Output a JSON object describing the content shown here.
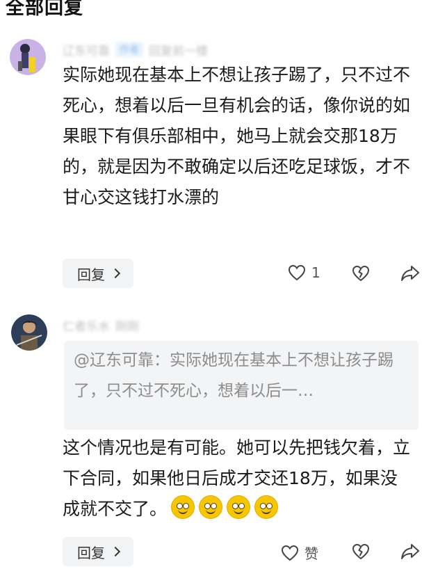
{
  "section_title": "全部回复",
  "comments": [
    {
      "username": "辽东可靠",
      "author_tag": "作者",
      "meta": "回复前一楼",
      "text": "实际她现在基本上不想让孩子踢了，只不过不死心，想着以后一旦有机会的话，像你说的如果眼下有俱乐部相中，她马上就会交那18万的，就是因为不敢确定以后还吃足球饭，才不甘心交这钱打水漂的",
      "reply_label": "回复",
      "like_count": "1"
    },
    {
      "username": "仁者乐水",
      "meta": "刚刚",
      "quote": "@辽东可靠：实际她现在基本上不想让孩子踢了，只不过不死心，想着以后一…",
      "text": "这个情况也是有可能。她可以先把钱欠着，立下合同，如果他日后成才交还18万，如果没成就不交了。",
      "reply_label": "回复",
      "like_label": "赞"
    }
  ]
}
